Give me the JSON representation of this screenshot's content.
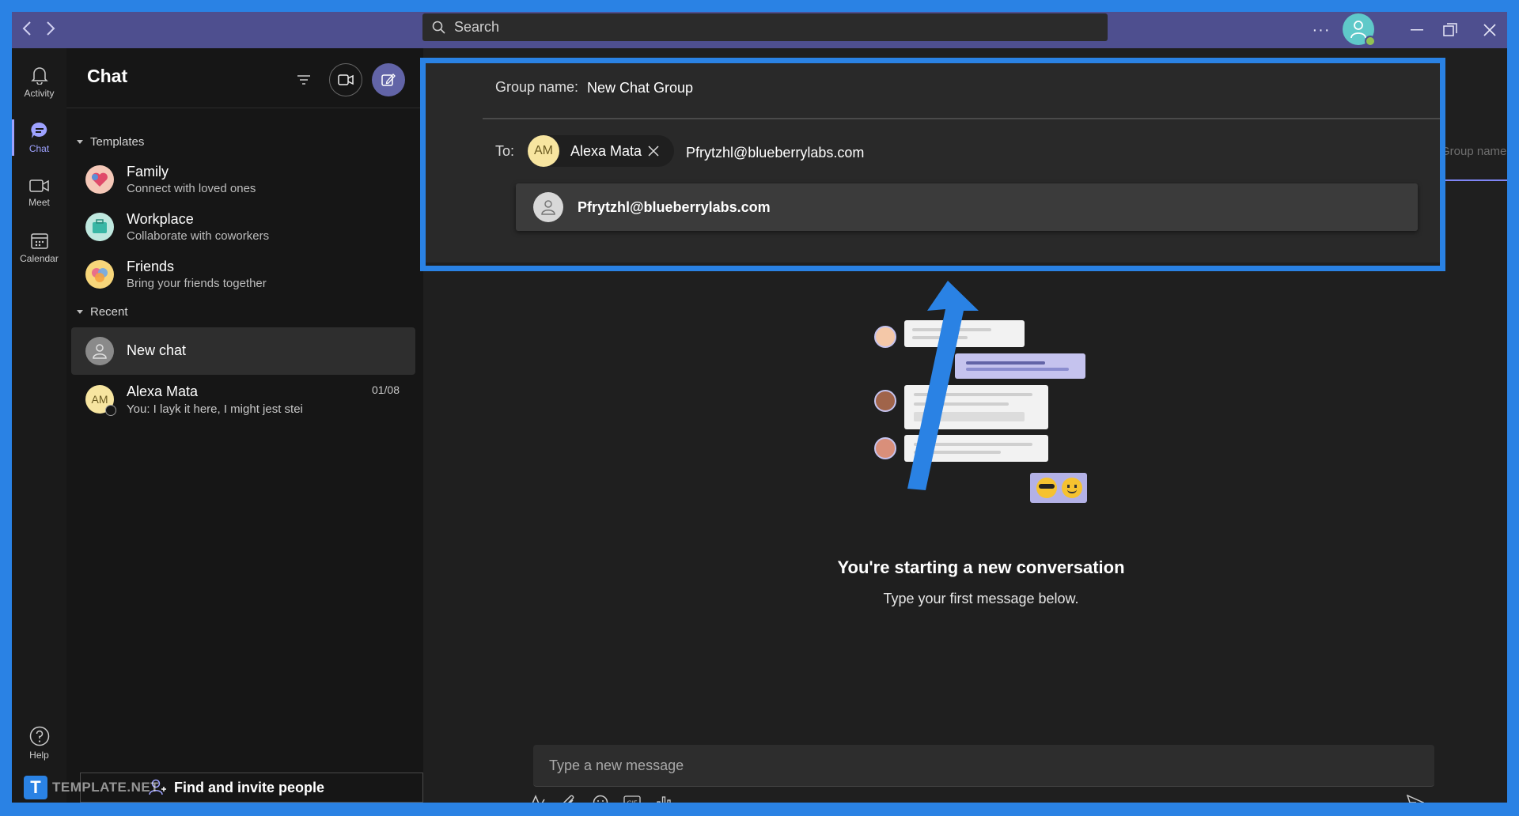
{
  "titlebar": {
    "search_placeholder": "Search",
    "back_icon": "chevron-left-icon",
    "forward_icon": "chevron-right-icon"
  },
  "rail": {
    "items": [
      {
        "label": "Activity",
        "icon": "bell-icon"
      },
      {
        "label": "Chat",
        "icon": "chat-icon"
      },
      {
        "label": "Meet",
        "icon": "video-icon"
      },
      {
        "label": "Calendar",
        "icon": "calendar-icon"
      }
    ],
    "help_label": "Help"
  },
  "chatlist": {
    "title": "Chat",
    "templates_label": "Templates",
    "templates": [
      {
        "name": "Family",
        "desc": "Connect with loved ones"
      },
      {
        "name": "Workplace",
        "desc": "Collaborate with coworkers"
      },
      {
        "name": "Friends",
        "desc": "Bring your friends together"
      }
    ],
    "recent_label": "Recent",
    "conversations": [
      {
        "name": "New chat",
        "preview": "",
        "time": ""
      },
      {
        "name": "Alexa Mata",
        "initials": "AM",
        "preview": "You: I layk it here, I might jest stei",
        "time": "01/08"
      }
    ],
    "invite_label": "Find and invite people"
  },
  "watermark": {
    "badge": "T",
    "text": "TEMPLATE.NET"
  },
  "compose": {
    "group_label": "Group name:",
    "group_value": "New Chat Group",
    "to_label": "To:",
    "recipient": {
      "initials": "AM",
      "name": "Alexa Mata"
    },
    "to_value": "Pfrytzhl@blueberrylabs.com",
    "group_name_ghost": "Group name",
    "suggestion": "Pfrytzhl@blueberrylabs.com"
  },
  "empty_state": {
    "title": "You're starting a new conversation",
    "subtitle": "Type your first message below."
  },
  "message_box": {
    "placeholder": "Type a new message"
  },
  "colors": {
    "accent": "#7f85f5",
    "highlight": "#2a82e4",
    "titlebar": "#4e4f8f"
  }
}
